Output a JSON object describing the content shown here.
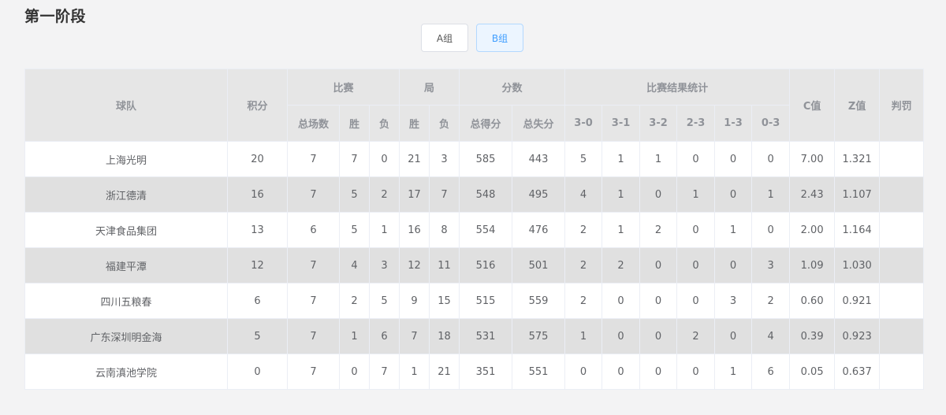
{
  "page": {
    "title": "第一阶段"
  },
  "group_tabs": [
    {
      "label": "A组",
      "active": false
    },
    {
      "label": "B组",
      "active": true
    }
  ],
  "table": {
    "headers": {
      "team": "球队",
      "points": "积分",
      "matches": "比赛",
      "sets": "局",
      "score": "分数",
      "result_stats": "比赛结果统计",
      "c_value": "C值",
      "z_value": "Z值",
      "penalty": "判罚",
      "matches_total": "总场数",
      "matches_won": "胜",
      "matches_lost": "负",
      "sets_won": "胜",
      "sets_lost": "负",
      "points_for": "总得分",
      "points_against": "总失分",
      "r30": "3-0",
      "r31": "3-1",
      "r32": "3-2",
      "r23": "2-3",
      "r13": "1-3",
      "r03": "0-3"
    },
    "rows": [
      {
        "team": "上海光明",
        "points": "20",
        "mt": "7",
        "mw": "7",
        "ml": "0",
        "sw": "21",
        "sl": "3",
        "pf": "585",
        "pa": "443",
        "r30": "5",
        "r31": "1",
        "r32": "1",
        "r23": "0",
        "r13": "0",
        "r03": "0",
        "c": "7.00",
        "z": "1.321",
        "penalty": ""
      },
      {
        "team": "浙江德清",
        "points": "16",
        "mt": "7",
        "mw": "5",
        "ml": "2",
        "sw": "17",
        "sl": "7",
        "pf": "548",
        "pa": "495",
        "r30": "4",
        "r31": "1",
        "r32": "0",
        "r23": "1",
        "r13": "0",
        "r03": "1",
        "c": "2.43",
        "z": "1.107",
        "penalty": ""
      },
      {
        "team": "天津食品集团",
        "points": "13",
        "mt": "6",
        "mw": "5",
        "ml": "1",
        "sw": "16",
        "sl": "8",
        "pf": "554",
        "pa": "476",
        "r30": "2",
        "r31": "1",
        "r32": "2",
        "r23": "0",
        "r13": "1",
        "r03": "0",
        "c": "2.00",
        "z": "1.164",
        "penalty": ""
      },
      {
        "team": "福建平潭",
        "points": "12",
        "mt": "7",
        "mw": "4",
        "ml": "3",
        "sw": "12",
        "sl": "11",
        "pf": "516",
        "pa": "501",
        "r30": "2",
        "r31": "2",
        "r32": "0",
        "r23": "0",
        "r13": "0",
        "r03": "3",
        "c": "1.09",
        "z": "1.030",
        "penalty": ""
      },
      {
        "team": "四川五粮春",
        "points": "6",
        "mt": "7",
        "mw": "2",
        "ml": "5",
        "sw": "9",
        "sl": "15",
        "pf": "515",
        "pa": "559",
        "r30": "2",
        "r31": "0",
        "r32": "0",
        "r23": "0",
        "r13": "3",
        "r03": "2",
        "c": "0.60",
        "z": "0.921",
        "penalty": ""
      },
      {
        "team": "广东深圳明金海",
        "points": "5",
        "mt": "7",
        "mw": "1",
        "ml": "6",
        "sw": "7",
        "sl": "18",
        "pf": "531",
        "pa": "575",
        "r30": "1",
        "r31": "0",
        "r32": "0",
        "r23": "2",
        "r13": "0",
        "r03": "4",
        "c": "0.39",
        "z": "0.923",
        "penalty": ""
      },
      {
        "team": "云南滇池学院",
        "points": "0",
        "mt": "7",
        "mw": "0",
        "ml": "7",
        "sw": "1",
        "sl": "21",
        "pf": "351",
        "pa": "551",
        "r30": "0",
        "r31": "0",
        "r32": "0",
        "r23": "0",
        "r13": "1",
        "r03": "6",
        "c": "0.05",
        "z": "0.637",
        "penalty": ""
      }
    ]
  }
}
